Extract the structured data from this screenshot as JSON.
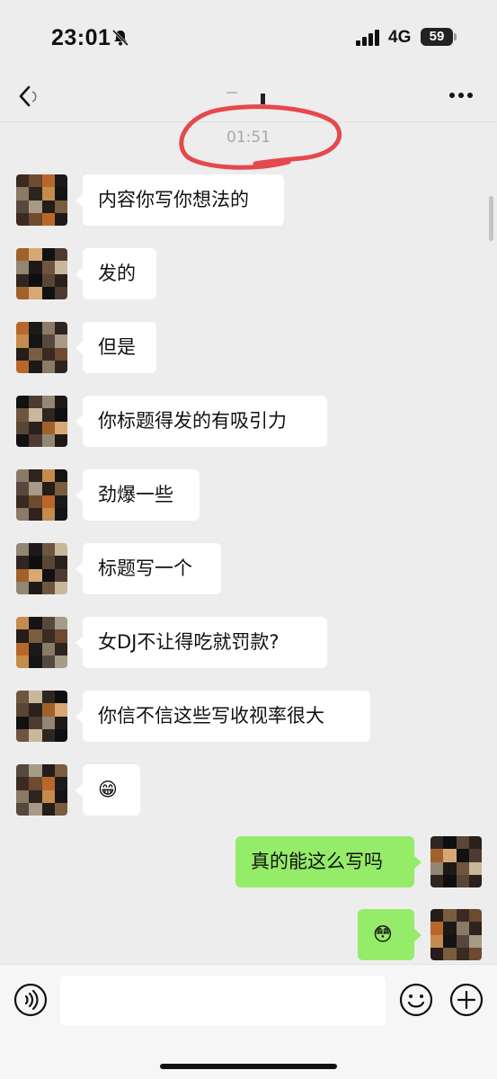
{
  "status_bar": {
    "time": "23:01",
    "network": "4G",
    "battery": "59"
  },
  "nav": {
    "title": ""
  },
  "chat": {
    "timestamp": "01:51",
    "messages": [
      {
        "from": "other",
        "text": "内容你写你想法的"
      },
      {
        "from": "other",
        "text": "发的"
      },
      {
        "from": "other",
        "text": "但是"
      },
      {
        "from": "other",
        "text": "你标题得发的有吸引力"
      },
      {
        "from": "other",
        "text": "劲爆一些"
      },
      {
        "from": "other",
        "text": "标题写一个"
      },
      {
        "from": "other",
        "text": "女DJ不让得吃就罚款?"
      },
      {
        "from": "other",
        "text": "你信不信这些写收视率很大"
      },
      {
        "from": "other",
        "text": "😁"
      },
      {
        "from": "self",
        "text": "真的能这么写吗"
      },
      {
        "from": "self",
        "text": "😳"
      }
    ]
  },
  "input_bar": {
    "placeholder": ""
  },
  "icons": [
    "bell-slash-icon",
    "signal-icon",
    "battery-icon",
    "back-icon",
    "more-icon",
    "voice-icon",
    "emoji-icon",
    "plus-icon"
  ],
  "colors": {
    "background": "#ededed",
    "self_bubble": "#95ec69",
    "other_bubble": "#ffffff",
    "timestamp": "#a8a8a8"
  }
}
